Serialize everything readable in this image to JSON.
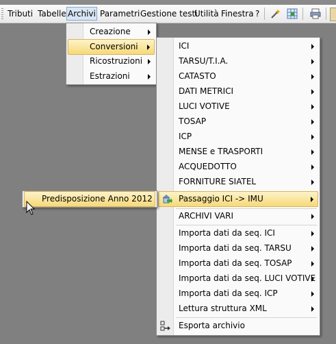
{
  "menubar": {
    "items": [
      "Tributi",
      "Tabelle",
      "Archivi",
      "Parametri",
      "Gestione testi",
      "Utilità",
      "Finestra",
      "?"
    ],
    "active": "Archivi"
  },
  "archivi_menu": {
    "items": [
      "Creazione",
      "Conversioni",
      "Ricostruzioni",
      "Estrazioni"
    ],
    "highlighted": "Conversioni"
  },
  "conversioni_menu": {
    "items": [
      "ICI",
      "TARSU/T.I.A.",
      "CATASTO",
      "DATI METRICI",
      "LUCI VOTIVE",
      "TOSAP",
      "ICP",
      "MENSE e TRASPORTI",
      "ACQUEDOTTO",
      "FORNITURE SIATEL",
      "Passaggio ICI -> IMU",
      "ARCHIVI VARI",
      "Importa dati da seq. ICI",
      "Importa dati da seq. TARSU",
      "Importa dati da seq. TOSAP",
      "Importa dati da seq. LUCI VOTIVE",
      "Importa dati da seq. ICP",
      "Lettura struttura XML",
      "Esporta archivio"
    ],
    "highlighted": "Passaggio ICI -> IMU"
  },
  "imu_menu": {
    "items": [
      "Predisposizione Anno 2012"
    ]
  },
  "icons": [
    "wand-icon",
    "grid-icon",
    "printer-icon",
    "house-arrow-icon",
    "export-icon",
    "mouse-cursor-icon"
  ],
  "colors": {
    "highlight": "#f7d978",
    "active_menu": "#d8e6f5"
  }
}
